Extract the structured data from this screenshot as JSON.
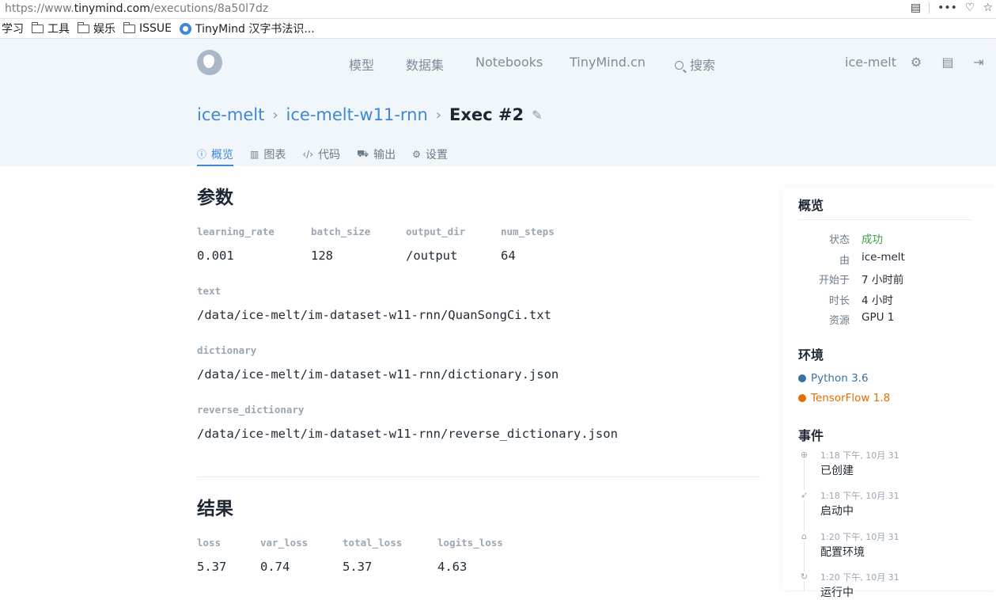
{
  "browser": {
    "url_prefix": "https://www.",
    "url_domain": "tinymind.com",
    "url_path": "/executions/8a50l7dz"
  },
  "bookmarks": [
    {
      "label": "学习",
      "icon": "none"
    },
    {
      "label": "工具",
      "icon": "folder-icon"
    },
    {
      "label": "娱乐",
      "icon": "folder-icon"
    },
    {
      "label": "ISSUE",
      "icon": "folder-icon"
    },
    {
      "label": "TinyMind 汉字书法识...",
      "icon": "tinymind-icon"
    }
  ],
  "nav": {
    "items": [
      "模型",
      "数据集",
      "Notebooks",
      "TinyMind.cn"
    ],
    "search_label": "搜索",
    "user": "ice-melt"
  },
  "breadcrumb": {
    "project": "ice-melt",
    "sub": "ice-melt-w11-rnn",
    "current": "Exec #2"
  },
  "tabs": [
    {
      "label": "概览",
      "icon": "info-icon",
      "active": true
    },
    {
      "label": "图表",
      "icon": "chart-icon",
      "active": false
    },
    {
      "label": "代码",
      "icon": "code-icon",
      "active": false
    },
    {
      "label": "输出",
      "icon": "truck-icon",
      "active": false
    },
    {
      "label": "设置",
      "icon": "gear-icon",
      "active": false
    }
  ],
  "params": {
    "title": "参数",
    "row1": [
      {
        "key": "learning_rate",
        "value": "0.001"
      },
      {
        "key": "batch_size",
        "value": "128"
      },
      {
        "key": "output_dir",
        "value": "/output"
      },
      {
        "key": "num_steps",
        "value": "64"
      }
    ],
    "text": {
      "key": "text",
      "value": "/data/ice-melt/im-dataset-w11-rnn/QuanSongCi.txt"
    },
    "dictionary": {
      "key": "dictionary",
      "value": "/data/ice-melt/im-dataset-w11-rnn/dictionary.json"
    },
    "reverse_dictionary": {
      "key": "reverse_dictionary",
      "value": "/data/ice-melt/im-dataset-w11-rnn/reverse_dictionary.json"
    }
  },
  "results": {
    "title": "结果",
    "row": [
      {
        "key": "loss",
        "value": "5.37"
      },
      {
        "key": "var_loss",
        "value": "0.74"
      },
      {
        "key": "total_loss",
        "value": "5.37"
      },
      {
        "key": "logits_loss",
        "value": "4.63"
      }
    ]
  },
  "sidebar": {
    "overview_title": "概览",
    "info": [
      {
        "label": "状态",
        "value": "成功",
        "color": "#3aa142"
      },
      {
        "label": "由",
        "value": "ice-melt"
      },
      {
        "label": "开始于",
        "value": "7 小时前"
      },
      {
        "label": "时长",
        "value": "4 小时"
      },
      {
        "label": "资源",
        "value": "GPU 1"
      }
    ],
    "env_title": "环境",
    "env": [
      {
        "label": "Python 3.6",
        "color": "#3572a5"
      },
      {
        "label": "TensorFlow 1.8",
        "color": "#e66c00"
      }
    ],
    "events_title": "事件",
    "events": [
      {
        "time": "1:18 下午, 10月 31",
        "name": "已创建",
        "icon": "plus-circle-icon"
      },
      {
        "time": "1:18 下午, 10月 31",
        "name": "启动中",
        "icon": "rocket-icon"
      },
      {
        "time": "1:20 下午, 10月 31",
        "name": "配置环境",
        "icon": "factory-icon"
      },
      {
        "time": "1:20 下午, 10月 31",
        "name": "运行中",
        "icon": "refresh-icon"
      }
    ]
  }
}
